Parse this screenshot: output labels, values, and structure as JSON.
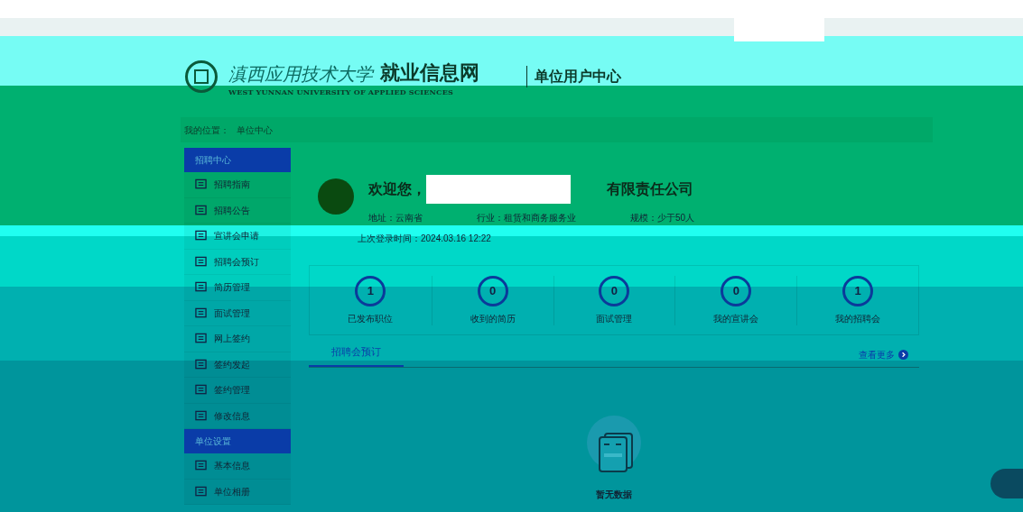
{
  "header": {
    "logo_text": "滇西应用技术大学",
    "site_title": "就业信息网",
    "subtitle": "WEST YUNNAN UNIVERSITY OF APPLIED SCIENCES",
    "center": "单位用户中心"
  },
  "breadcrumb": {
    "label": "我的位置：",
    "current": "单位中心"
  },
  "sidebar": [
    {
      "title": "招聘中心",
      "selected": true,
      "items": [
        "招聘指南",
        "招聘公告",
        "宣讲会申请",
        "招聘会预订",
        "简历管理",
        "面试管理",
        "网上签约",
        "签约发起",
        "签约管理",
        "修改信息"
      ]
    },
    {
      "title": "单位设置",
      "selected": true,
      "items": [
        "基本信息",
        "单位相册"
      ]
    }
  ],
  "profile": {
    "welcome": "欢迎您，",
    "company_suffix": "有限责任公司",
    "fields": [
      {
        "label": "地址：",
        "value": "云南省"
      },
      {
        "label": "行业：",
        "value": "租赁和商务服务业"
      },
      {
        "label": "规模：",
        "value": "少于50人"
      }
    ],
    "last_login_label": "上次登录时间：",
    "last_login": "2024.03.16 12:22"
  },
  "stats": [
    {
      "count": "1",
      "label": "已发布职位"
    },
    {
      "count": "0",
      "label": "收到的简历"
    },
    {
      "count": "0",
      "label": "面试管理"
    },
    {
      "count": "0",
      "label": "我的宣讲会"
    },
    {
      "count": "1",
      "label": "我的招聘会"
    }
  ],
  "tabs": [
    {
      "label": "招聘会预订",
      "selected": true
    }
  ],
  "more": "查看更多",
  "empty": "暂无数据"
}
